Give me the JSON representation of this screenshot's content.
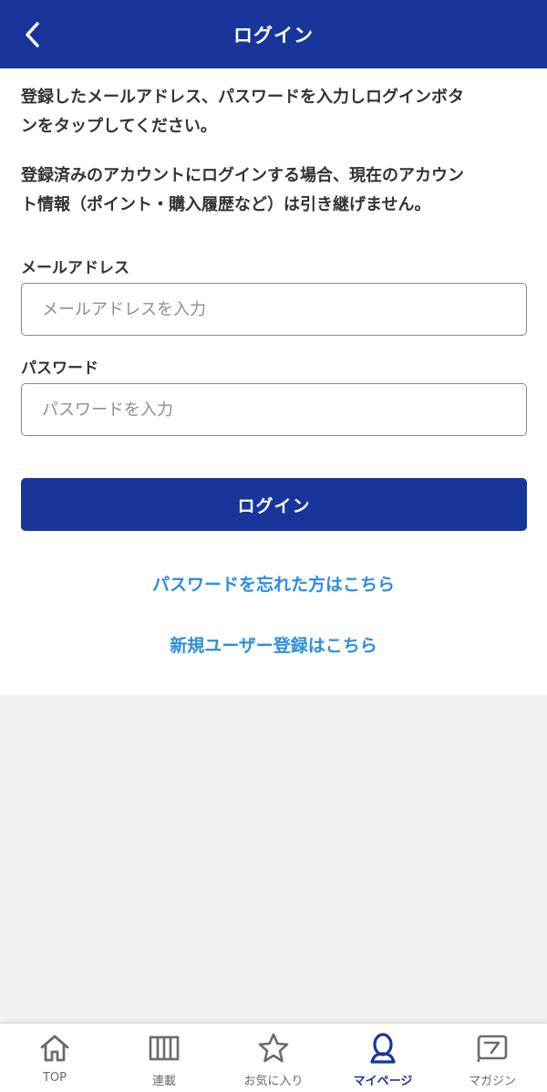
{
  "header": {
    "title": "ログイン",
    "bg_color": "#18369a",
    "back_icon": "chevron-left-icon"
  },
  "intro": {
    "paragraph1_line1": "登録したメールアドレス、パスワードを入力しログインボタ",
    "paragraph1_line2": "ンをタップしてください。",
    "paragraph2_line1": "登録済みのアカウントにログインする場合、現在のアカウン",
    "paragraph2_line2": "ト情報（ポイント・購入履歴など）は引き継げません。"
  },
  "form": {
    "email_label": "メールアドレス",
    "email_value": "",
    "email_placeholder": "メールアドレスを入力",
    "password_label": "パスワード",
    "password_value": "",
    "password_placeholder": "パスワードを入力",
    "login_button": "ログイン"
  },
  "links": {
    "forgot_password": "パスワードを忘れた方はこちら",
    "register": "新規ユーザー登録はこちら",
    "color": "#2a8ee0"
  },
  "tabbar": {
    "items": [
      {
        "label": "TOP",
        "icon": "home-icon",
        "active": false
      },
      {
        "label": "連載",
        "icon": "book-icon",
        "active": false
      },
      {
        "label": "お気に入り",
        "icon": "star-icon",
        "active": false
      },
      {
        "label": "マイページ",
        "icon": "user-icon",
        "active": true
      },
      {
        "label": "マガジン",
        "icon": "magazine-icon",
        "active": false
      }
    ],
    "active_color": "#18369a",
    "inactive_color": "#6b6b6b"
  }
}
